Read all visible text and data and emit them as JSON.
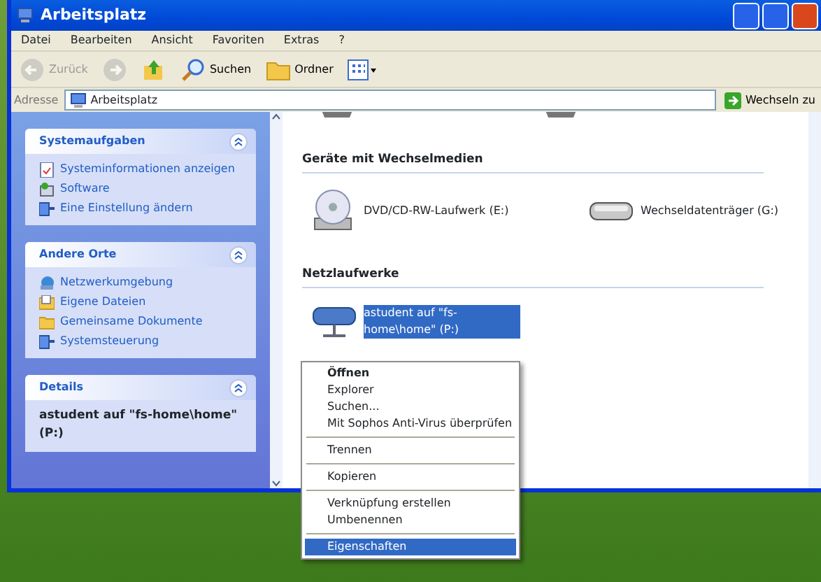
{
  "window": {
    "title": "Arbeitsplatz"
  },
  "menu_bar": [
    "Datei",
    "Bearbeiten",
    "Ansicht",
    "Favoriten",
    "Extras",
    "?"
  ],
  "toolbar": [
    {
      "kind": "back",
      "label": "Zurück",
      "disabled": true
    },
    {
      "kind": "forward",
      "disabled": true
    },
    {
      "kind": "up",
      "disabled": false
    },
    {
      "kind": "search",
      "label": "Suchen",
      "disabled": false
    },
    {
      "kind": "folders",
      "label": "Ordner",
      "disabled": false
    },
    {
      "kind": "views",
      "disabled": false
    }
  ],
  "address_bar": {
    "label": "Adresse",
    "value": "Arbeitsplatz",
    "go_button": "Wechseln zu"
  },
  "sidebar": {
    "panels": [
      {
        "title": "Systemaufgaben",
        "expanded": true,
        "items": [
          {
            "label": "Systeminformationen anzeigen",
            "kind": "info"
          },
          {
            "label": "Software",
            "kind": "software"
          },
          {
            "label": "Eine Einstellung ändern",
            "kind": "control"
          }
        ]
      },
      {
        "title": "Andere Orte",
        "expanded": true,
        "items": [
          {
            "label": "Netzwerkumgebung",
            "kind": "network"
          },
          {
            "label": "Eigene Dateien",
            "kind": "docs"
          },
          {
            "label": "Gemeinsame Dokumente",
            "kind": "folder"
          },
          {
            "label": "Systemsteuerung",
            "kind": "control"
          }
        ]
      },
      {
        "title": "Details",
        "expanded": true,
        "detail": "astudent auf \"fs-home\\home\" (P:)"
      }
    ]
  },
  "content": {
    "groups": [
      {
        "title": "Geräte mit Wechselmedien",
        "items": [
          {
            "label": "DVD/CD-RW-Laufwerk (E:)",
            "kind": "cdrom",
            "selected": false
          },
          {
            "label": "Wechseldatenträger (G:)",
            "kind": "removable",
            "selected": false
          }
        ]
      },
      {
        "title": "Netzlaufwerke",
        "items": [
          {
            "label": "astudent auf \"fs-home\\home\" (P:)",
            "kind": "network",
            "selected": true
          }
        ]
      }
    ]
  },
  "context_menu": {
    "items": [
      {
        "kind": "item",
        "label": "Öffnen",
        "default": true,
        "selected": false
      },
      {
        "kind": "item",
        "label": "Explorer",
        "default": false,
        "selected": false
      },
      {
        "kind": "item",
        "label": "Suchen...",
        "default": false,
        "selected": false
      },
      {
        "kind": "item",
        "label": "Mit Sophos Anti-Virus überprüfen",
        "default": false,
        "selected": false
      },
      {
        "kind": "separator"
      },
      {
        "kind": "item",
        "label": "Trennen",
        "default": false,
        "selected": false
      },
      {
        "kind": "separator"
      },
      {
        "kind": "item",
        "label": "Kopieren",
        "default": false,
        "selected": false
      },
      {
        "kind": "separator"
      },
      {
        "kind": "item",
        "label": "Verknüpfung erstellen",
        "default": false,
        "selected": false
      },
      {
        "kind": "item",
        "label": "Umbenennen",
        "default": false,
        "selected": false
      },
      {
        "kind": "separator"
      },
      {
        "kind": "item",
        "label": "Eigenschaften",
        "default": false,
        "selected": true
      }
    ]
  }
}
